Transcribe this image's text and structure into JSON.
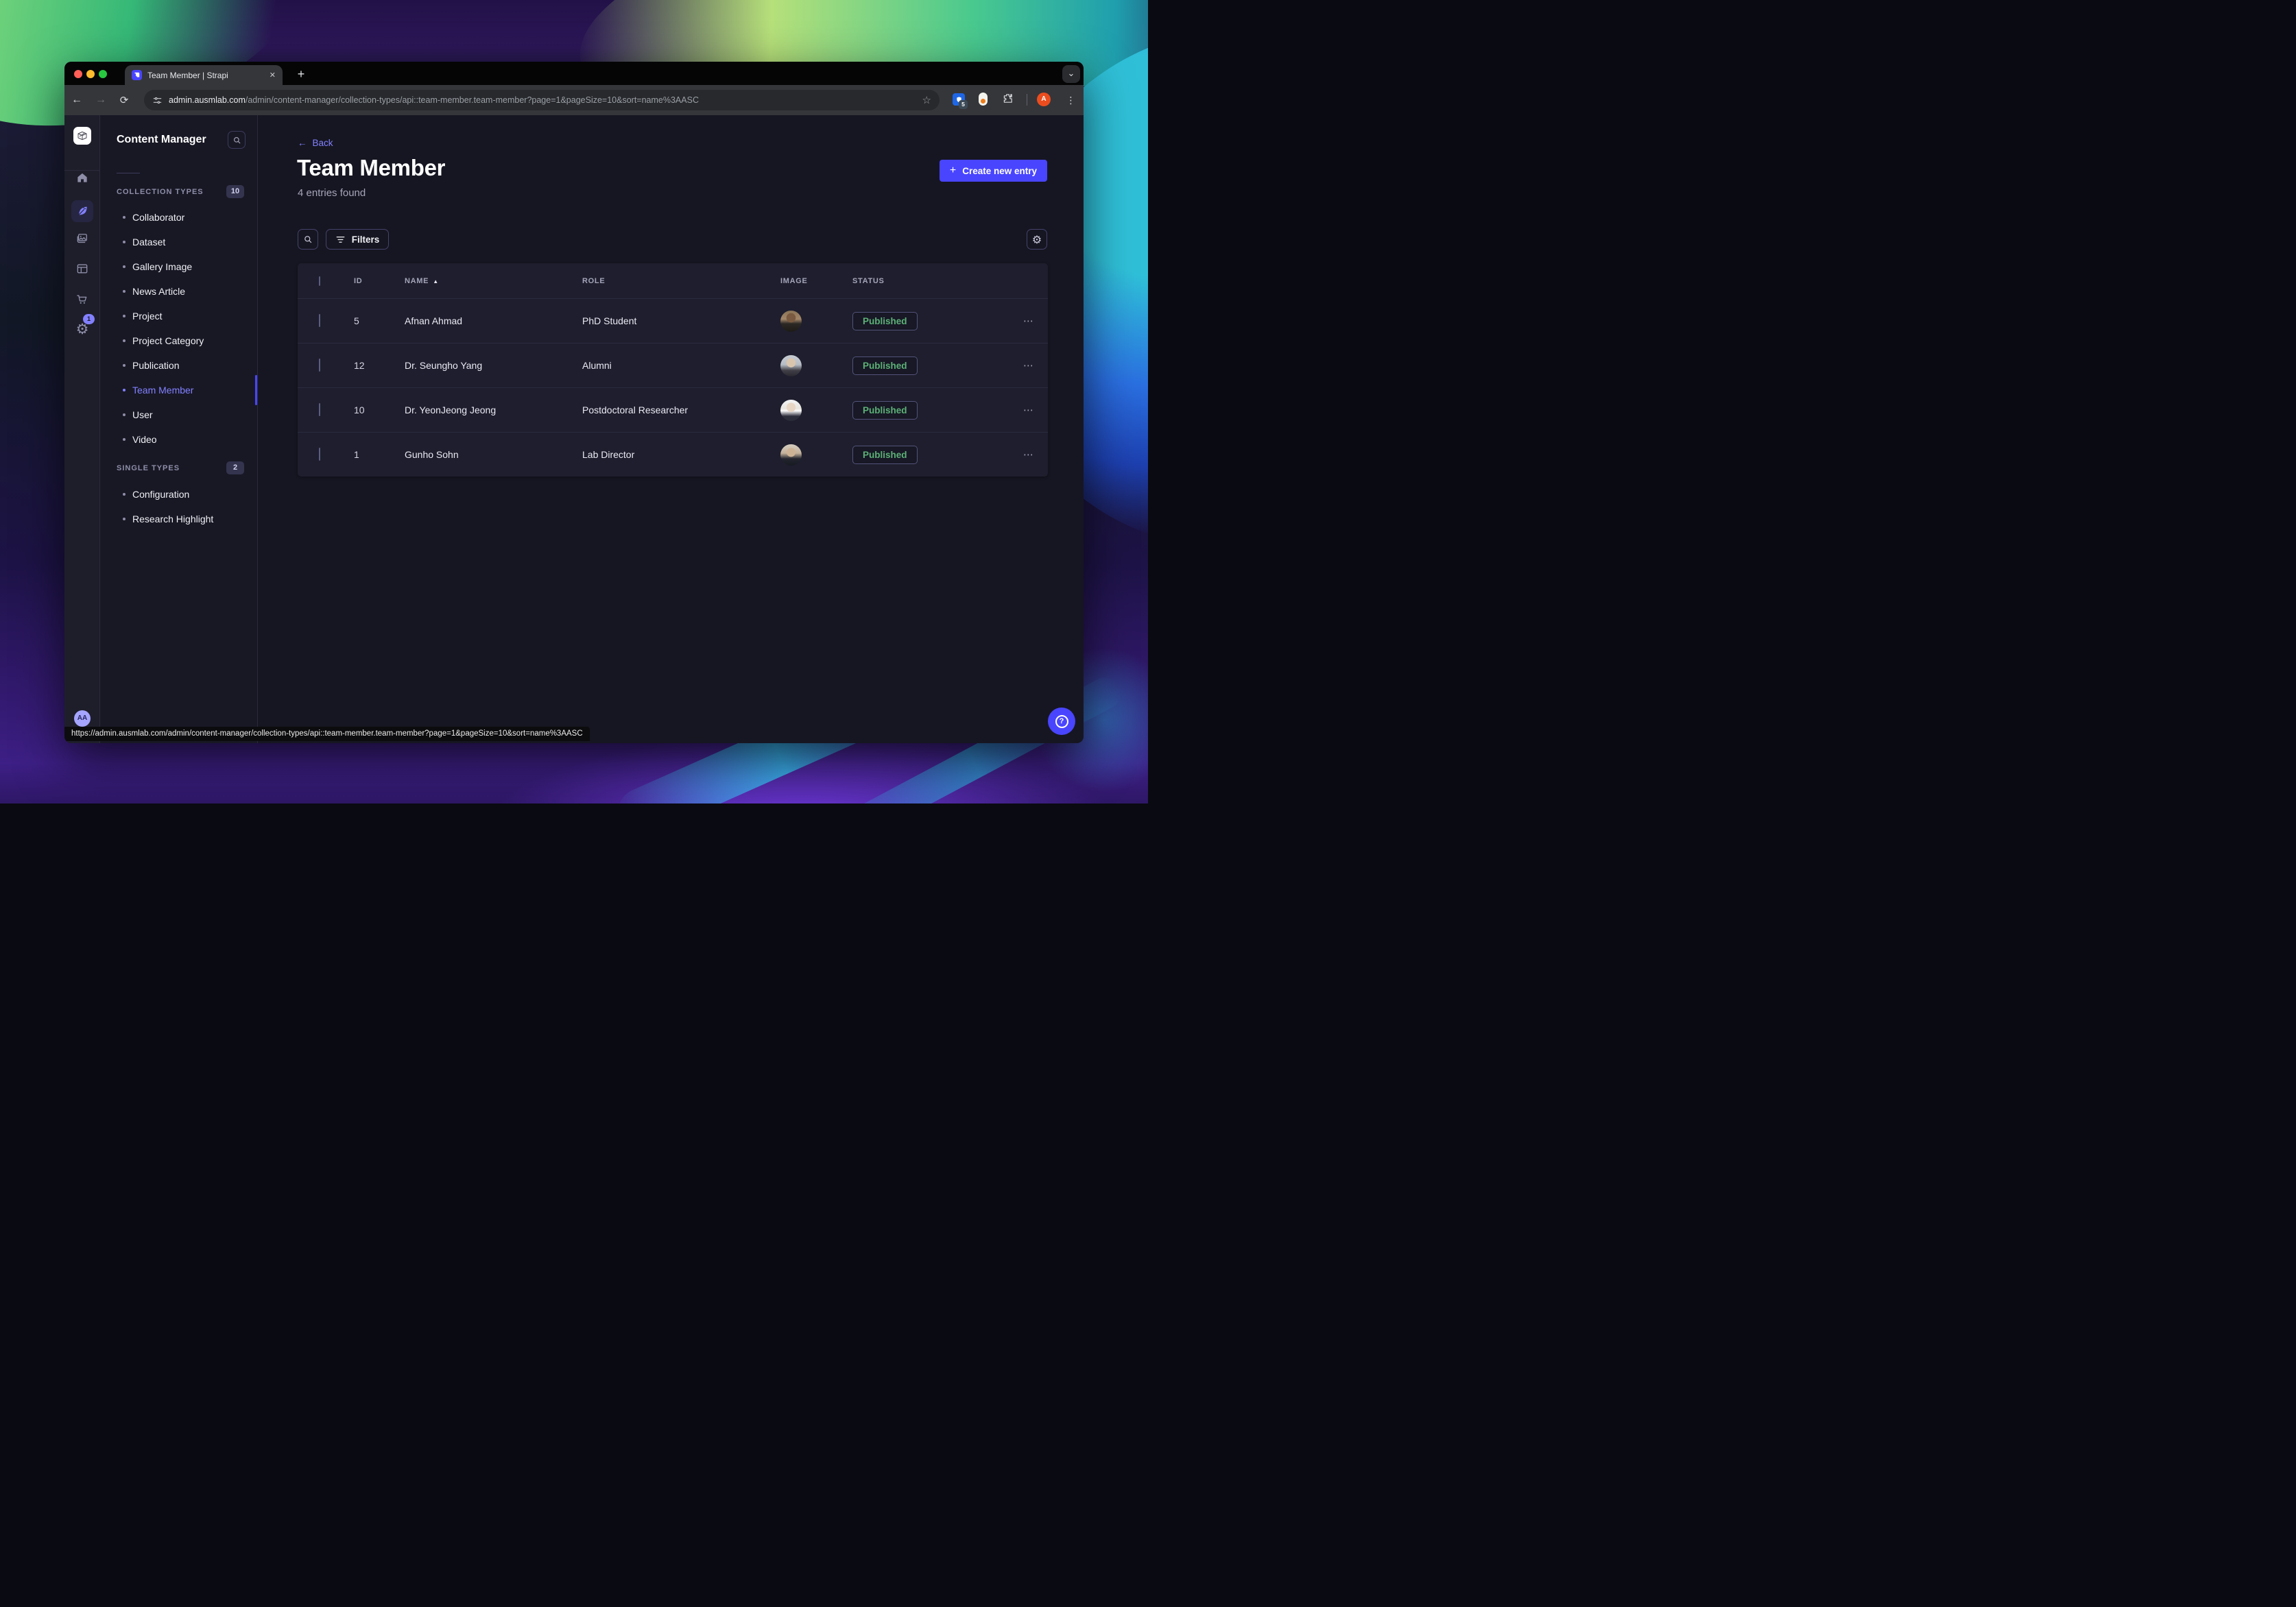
{
  "browser": {
    "tab_title": "Team Member | Strapi",
    "close_glyph": "✕",
    "new_tab_glyph": "+",
    "chevron_glyph": "⌄",
    "back_glyph": "←",
    "forward_glyph": "→",
    "reload_glyph": "⟳",
    "url_domain": "admin.ausmlab.com",
    "url_path": "/admin/content-manager/collection-types/api::team-member.team-member?page=1&pageSize=10&sort=name%3AASC",
    "star_glyph": "☆",
    "extension_badge": "5",
    "profile_initial": "A",
    "kebab_glyph": "⋮",
    "status_url": "https://admin.ausmlab.com/admin/content-manager/collection-types/api::team-member.team-member?page=1&pageSize=10&sort=name%3AASC"
  },
  "rail": {
    "settings_badge": "1",
    "settings_glyph": "⚙",
    "user_initials": "AA"
  },
  "nav": {
    "title": "Content Manager",
    "collection_types_label": "COLLECTION TYPES",
    "collection_types_count": "10",
    "items": [
      "Collaborator",
      "Dataset",
      "Gallery Image",
      "News Article",
      "Project",
      "Project Category",
      "Publication",
      "Team Member",
      "User",
      "Video"
    ],
    "single_types_label": "SINGLE TYPES",
    "single_types_count": "2",
    "single_items": [
      "Configuration",
      "Research Highlight"
    ]
  },
  "header": {
    "back_arrow": "←",
    "back_label": "Back",
    "title": "Team Member",
    "subtitle": "4 entries found",
    "plus_glyph": "+",
    "create_label": "Create new entry"
  },
  "filters": {
    "label": "Filters"
  },
  "table": {
    "col_id": "ID",
    "col_name": "NAME",
    "col_role": "ROLE",
    "col_image": "IMAGE",
    "col_status": "STATUS",
    "sort_glyph": "▲",
    "row_menu_glyph": "⋯",
    "rows": [
      {
        "id": "5",
        "name": "Afnan Ahmad",
        "role": "PhD Student",
        "status": "Published"
      },
      {
        "id": "12",
        "name": "Dr. Seungho Yang",
        "role": "Alumni",
        "status": "Published"
      },
      {
        "id": "10",
        "name": "Dr. YeonJeong Jeong",
        "role": "Postdoctoral Researcher",
        "status": "Published"
      },
      {
        "id": "1",
        "name": "Gunho Sohn",
        "role": "Lab Director",
        "status": "Published"
      }
    ]
  },
  "fab": {
    "help_glyph": "?"
  },
  "colors": {
    "primary": "#4945ff",
    "primary_light": "#8280ff",
    "success": "#5cb176"
  }
}
